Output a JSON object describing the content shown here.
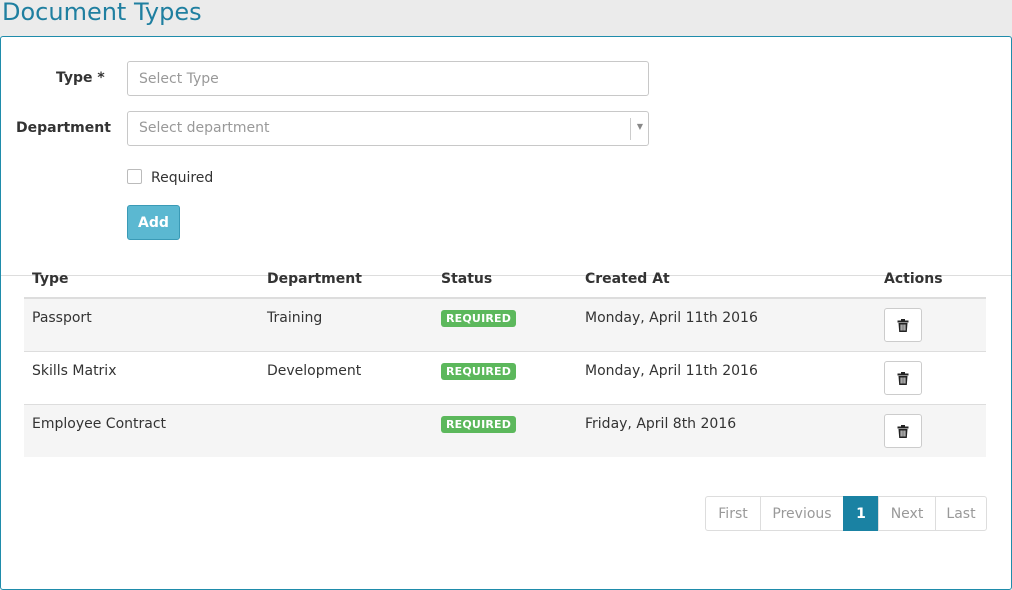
{
  "page": {
    "title": "Document Types"
  },
  "form": {
    "type_label": "Type",
    "type_required_mark": "*",
    "type_placeholder": "Select Type",
    "type_value": "",
    "department_label": "Department",
    "department_placeholder": "Select department",
    "required_label": "Required",
    "required_checked": false,
    "add_label": "Add"
  },
  "table": {
    "columns": [
      "Type",
      "Department",
      "Status",
      "Created At",
      "Actions"
    ],
    "rows": [
      {
        "type": "Passport",
        "department": "Training",
        "status": "REQUIRED",
        "created_at": "Monday, April 11th 2016",
        "action_icon": "trash-icon"
      },
      {
        "type": "Skills Matrix",
        "department": "Development",
        "status": "REQUIRED",
        "created_at": "Monday, April 11th 2016",
        "action_icon": "trash-icon"
      },
      {
        "type": "Employee Contract",
        "department": "",
        "status": "REQUIRED",
        "created_at": "Friday, April 8th 2016",
        "action_icon": "trash-icon"
      }
    ]
  },
  "pagination": {
    "first": "First",
    "previous": "Previous",
    "current": "1",
    "next": "Next",
    "last": "Last"
  },
  "colors": {
    "title": "#1f7fa0",
    "panel_border": "#1f8cab",
    "add_button": "#5bb8d1",
    "badge_required": "#5cb85c",
    "pagination_active": "#1a82a3"
  }
}
